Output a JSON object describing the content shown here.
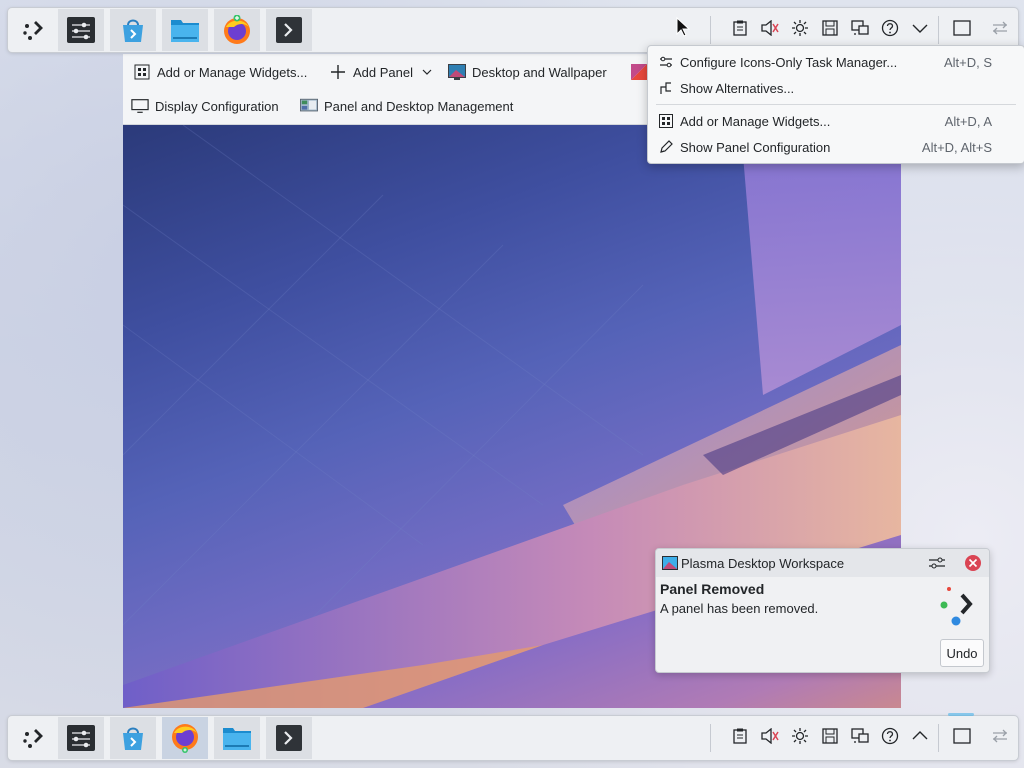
{
  "edit_toolbar": {
    "add_widgets": "Add or Manage Widgets...",
    "add_panel": "Add Panel",
    "desktop_wallpaper": "Desktop and Wallpaper",
    "display_config": "Display Configuration",
    "panel_desktop_mgmt": "Panel and Desktop Management"
  },
  "context_menu": {
    "items": [
      {
        "label": "Configure Icons-Only Task Manager...",
        "shortcut": "Alt+D, S",
        "icon": "configure-icon"
      },
      {
        "label": "Show Alternatives...",
        "shortcut": "",
        "icon": "alternatives-icon"
      },
      {
        "label": "Add or Manage Widgets...",
        "shortcut": "Alt+D, A",
        "icon": "widgets-icon"
      },
      {
        "label": "Show Panel Configuration",
        "shortcut": "Alt+D, Alt+S",
        "icon": "edit-icon"
      }
    ]
  },
  "notification": {
    "app_name": "Plasma Desktop Workspace",
    "title": "Panel Removed",
    "body": "A panel has been removed.",
    "action": "Undo"
  },
  "taskbar": {
    "apps": [
      "app-launcher-icon",
      "system-settings-icon",
      "discover-icon",
      "file-manager-icon",
      "firefox-icon",
      "konsole-icon"
    ],
    "tray": [
      "clipboard-icon",
      "volume-muted-icon",
      "brightness-icon",
      "save-icon",
      "network-icon",
      "help-icon",
      "chevron-icon",
      "show-desktop-icon",
      "panel-config-icon"
    ]
  },
  "colors": {
    "accent": "#3daee9",
    "close_red": "#da4453"
  }
}
